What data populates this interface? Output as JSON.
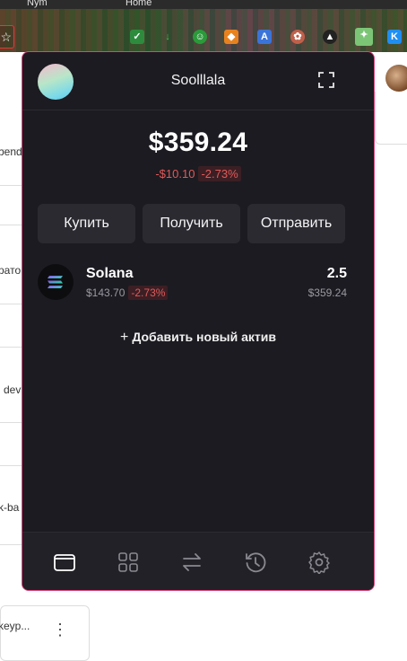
{
  "browser": {
    "tabs": [
      "Nym",
      "Home"
    ],
    "extensions": [
      "shield-check",
      "download",
      "face",
      "metamask-fox",
      "translate",
      "puzzle",
      "circle-extension",
      "phantom-ghost",
      "k-extension"
    ]
  },
  "background_page": {
    "snippets": [
      "pend",
      "рато",
      "dev",
      "k-ba",
      "keyp..."
    ]
  },
  "wallet": {
    "account_name": "Soolllala",
    "balance": "$359.24",
    "change_amount": "-$10.10",
    "change_percent": "-2.73%",
    "actions": {
      "buy": "Купить",
      "receive": "Получить",
      "send": "Отправить"
    },
    "assets": [
      {
        "name": "Solana",
        "price": "$143.70",
        "change": "-2.73%",
        "amount": "2.5",
        "value": "$359.24"
      }
    ],
    "add_asset_label": "Добавить новый актив",
    "nav": [
      "wallet",
      "apps",
      "swap",
      "history",
      "settings"
    ]
  },
  "colors": {
    "popup_bg": "#1c1b21",
    "popup_border": "#e0447c",
    "negative": "#e05a5a",
    "button_bg": "#2b2a31"
  }
}
